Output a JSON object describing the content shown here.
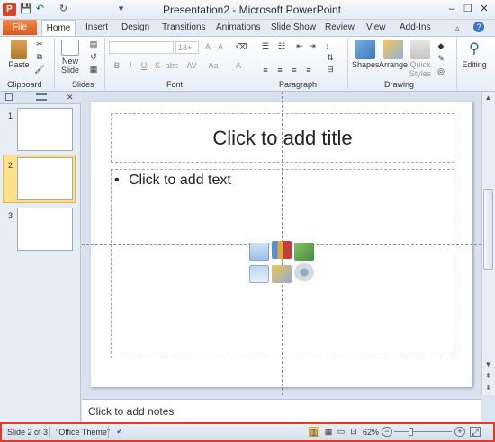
{
  "window": {
    "title": "Presentation2 - Microsoft PowerPoint",
    "app_logo": "P",
    "minimize": "–",
    "restore": "❐",
    "close": "✕"
  },
  "qat": {
    "save": "💾",
    "undo": "↶",
    "redo": "↻",
    "dropdown": "▾"
  },
  "tabs": {
    "file": "File",
    "home": "Home",
    "items": [
      "Insert",
      "Design",
      "Transitions",
      "Animations",
      "Slide Show",
      "Review",
      "View",
      "Add-Ins"
    ]
  },
  "ribbon": {
    "clipboard": {
      "label": "Clipboard",
      "paste": "Paste"
    },
    "slides": {
      "label": "Slides",
      "new_slide": "New Slide"
    },
    "font": {
      "label": "Font",
      "size_value": "18+",
      "bold": "B",
      "italic": "I",
      "underline": "U",
      "strike": "S",
      "shadow": "abc",
      "spacing": "AV",
      "case": "Aa",
      "color": "A"
    },
    "paragraph": {
      "label": "Paragraph"
    },
    "drawing": {
      "label": "Drawing",
      "shapes": "Shapes",
      "arrange": "Arrange",
      "quick_styles": "Quick Styles"
    },
    "editing": {
      "label": "Editing"
    }
  },
  "thumbnails": [
    "1",
    "2",
    "3"
  ],
  "slide": {
    "title_placeholder": "Click to add title",
    "body_bullet": "•",
    "body_placeholder": "Click to add text"
  },
  "notes": {
    "placeholder": "Click to add notes"
  },
  "status": {
    "slide_info": "Slide 2 of 3",
    "theme": "\"Office Theme\"",
    "zoom": "62%",
    "zoom_out": "−",
    "zoom_in": "+"
  },
  "colors": {
    "file_tab": "#d9581b",
    "accent": "#2b579a",
    "status_highlight": "#e23b2a",
    "selected_thumb": "#fde08a"
  }
}
